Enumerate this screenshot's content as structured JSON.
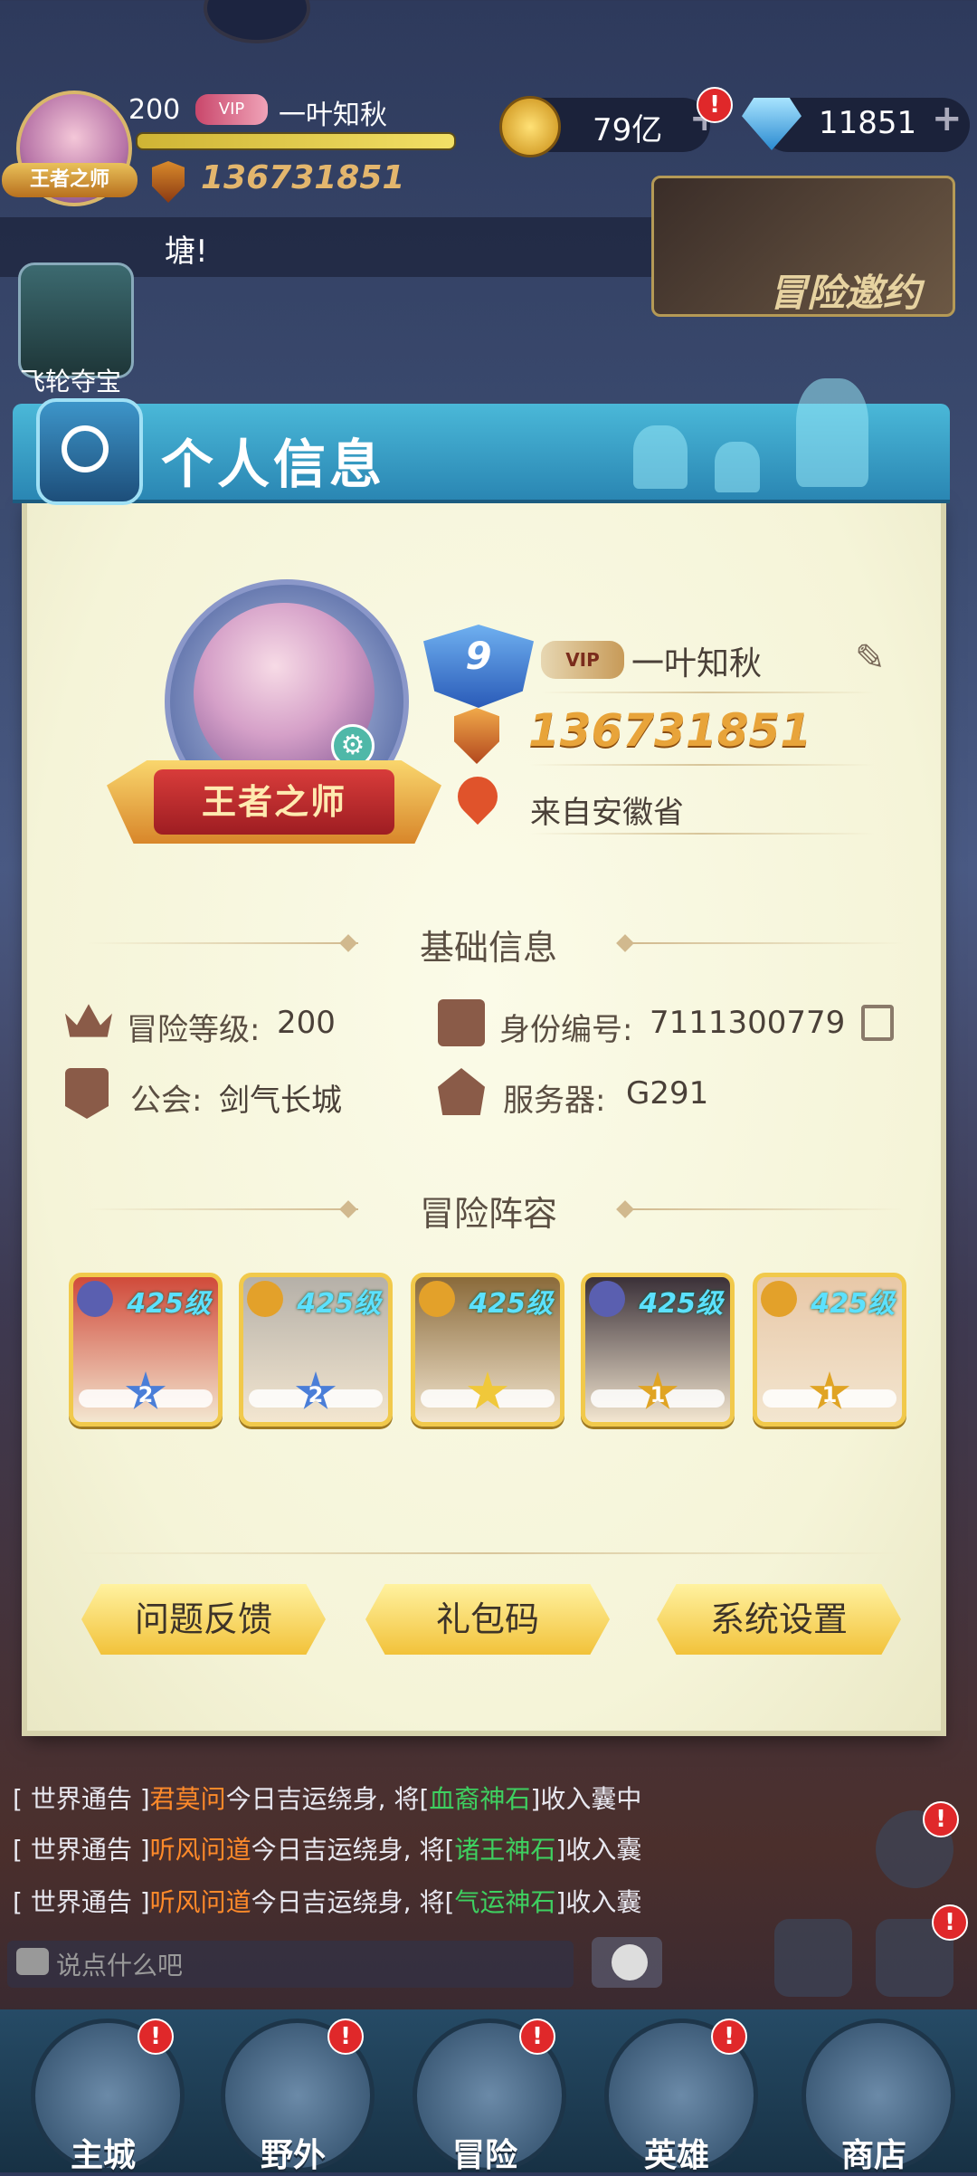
{
  "hud": {
    "level": "200",
    "vip": "VIP",
    "player_name": "一叶知秋",
    "avatar_title": "王者之师",
    "power": "136731851",
    "coins": "79亿",
    "gems": "11851",
    "plus": "+",
    "alert": "!"
  },
  "chat_top": {
    "text": "塘!"
  },
  "invite": {
    "label": "冒险邀约"
  },
  "flywheel": {
    "label": "飞轮夺宝"
  },
  "panel": {
    "title": "个人信息",
    "profile": {
      "frame_title": "王者之师",
      "level_badge": "9",
      "vip": "VIP",
      "name": "一叶知秋",
      "power": "136731851",
      "location": "来自安徽省"
    },
    "basic": {
      "title": "基础信息",
      "adv_level_label": "冒险等级:",
      "adv_level_value": "200",
      "id_label": "身份编号:",
      "id_value": "7111300779",
      "guild_label": "公会:",
      "guild_value": "剑气长城",
      "server_label": "服务器:",
      "server_value": "G291"
    },
    "lineup": {
      "title": "冒险阵容",
      "heroes": [
        {
          "level": "425级",
          "stars": "2",
          "type_color": "#5a5fb0",
          "bg": "#d04a3a"
        },
        {
          "level": "425级",
          "stars": "2",
          "type_color": "#e3a12a",
          "bg": "#b5b0a8"
        },
        {
          "level": "425级",
          "stars": "",
          "type_color": "#e3a12a",
          "bg": "#8a6a3a"
        },
        {
          "level": "425级",
          "stars": "1",
          "type_color": "#5a5fb0",
          "bg": "#3a3038"
        },
        {
          "level": "425级",
          "stars": "1",
          "type_color": "#e3a12a",
          "bg": "#e8c8a8"
        }
      ]
    },
    "buttons": {
      "feedback": "问题反馈",
      "gift_code": "礼包码",
      "settings": "系统设置"
    }
  },
  "chat": {
    "lines": [
      {
        "prefix": "[ 世界通告 ]",
        "player": "君莫问",
        "mid": "今日吉运绕身, 将[",
        "item": "血裔神石",
        "tail": "]收入囊中"
      },
      {
        "prefix": "[ 世界通告 ]",
        "player": "听风问道",
        "mid": "今日吉运绕身, 将[",
        "item": "诸王神石",
        "tail": "]收入囊"
      },
      {
        "prefix": "[ 世界通告 ]",
        "player": "听风问道",
        "mid": "今日吉运绕身, 将[",
        "item": "气运神石",
        "tail": "]收入囊"
      }
    ],
    "placeholder": "说点什么吧"
  },
  "nav": {
    "items": [
      {
        "label": "主城"
      },
      {
        "label": "野外"
      },
      {
        "label": "冒险"
      },
      {
        "label": "英雄"
      },
      {
        "label": "商店"
      }
    ]
  },
  "colors": {
    "panel_bg": "#f5f4d8",
    "header_blue": "#2a86b3",
    "gold": "#f2c23a",
    "power_orange": "#e8a43a",
    "player_orange": "#ff8a2a",
    "item_green": "#3ed060",
    "hero_level_cyan": "#5ce1ff",
    "alert_red": "#e0282a"
  }
}
